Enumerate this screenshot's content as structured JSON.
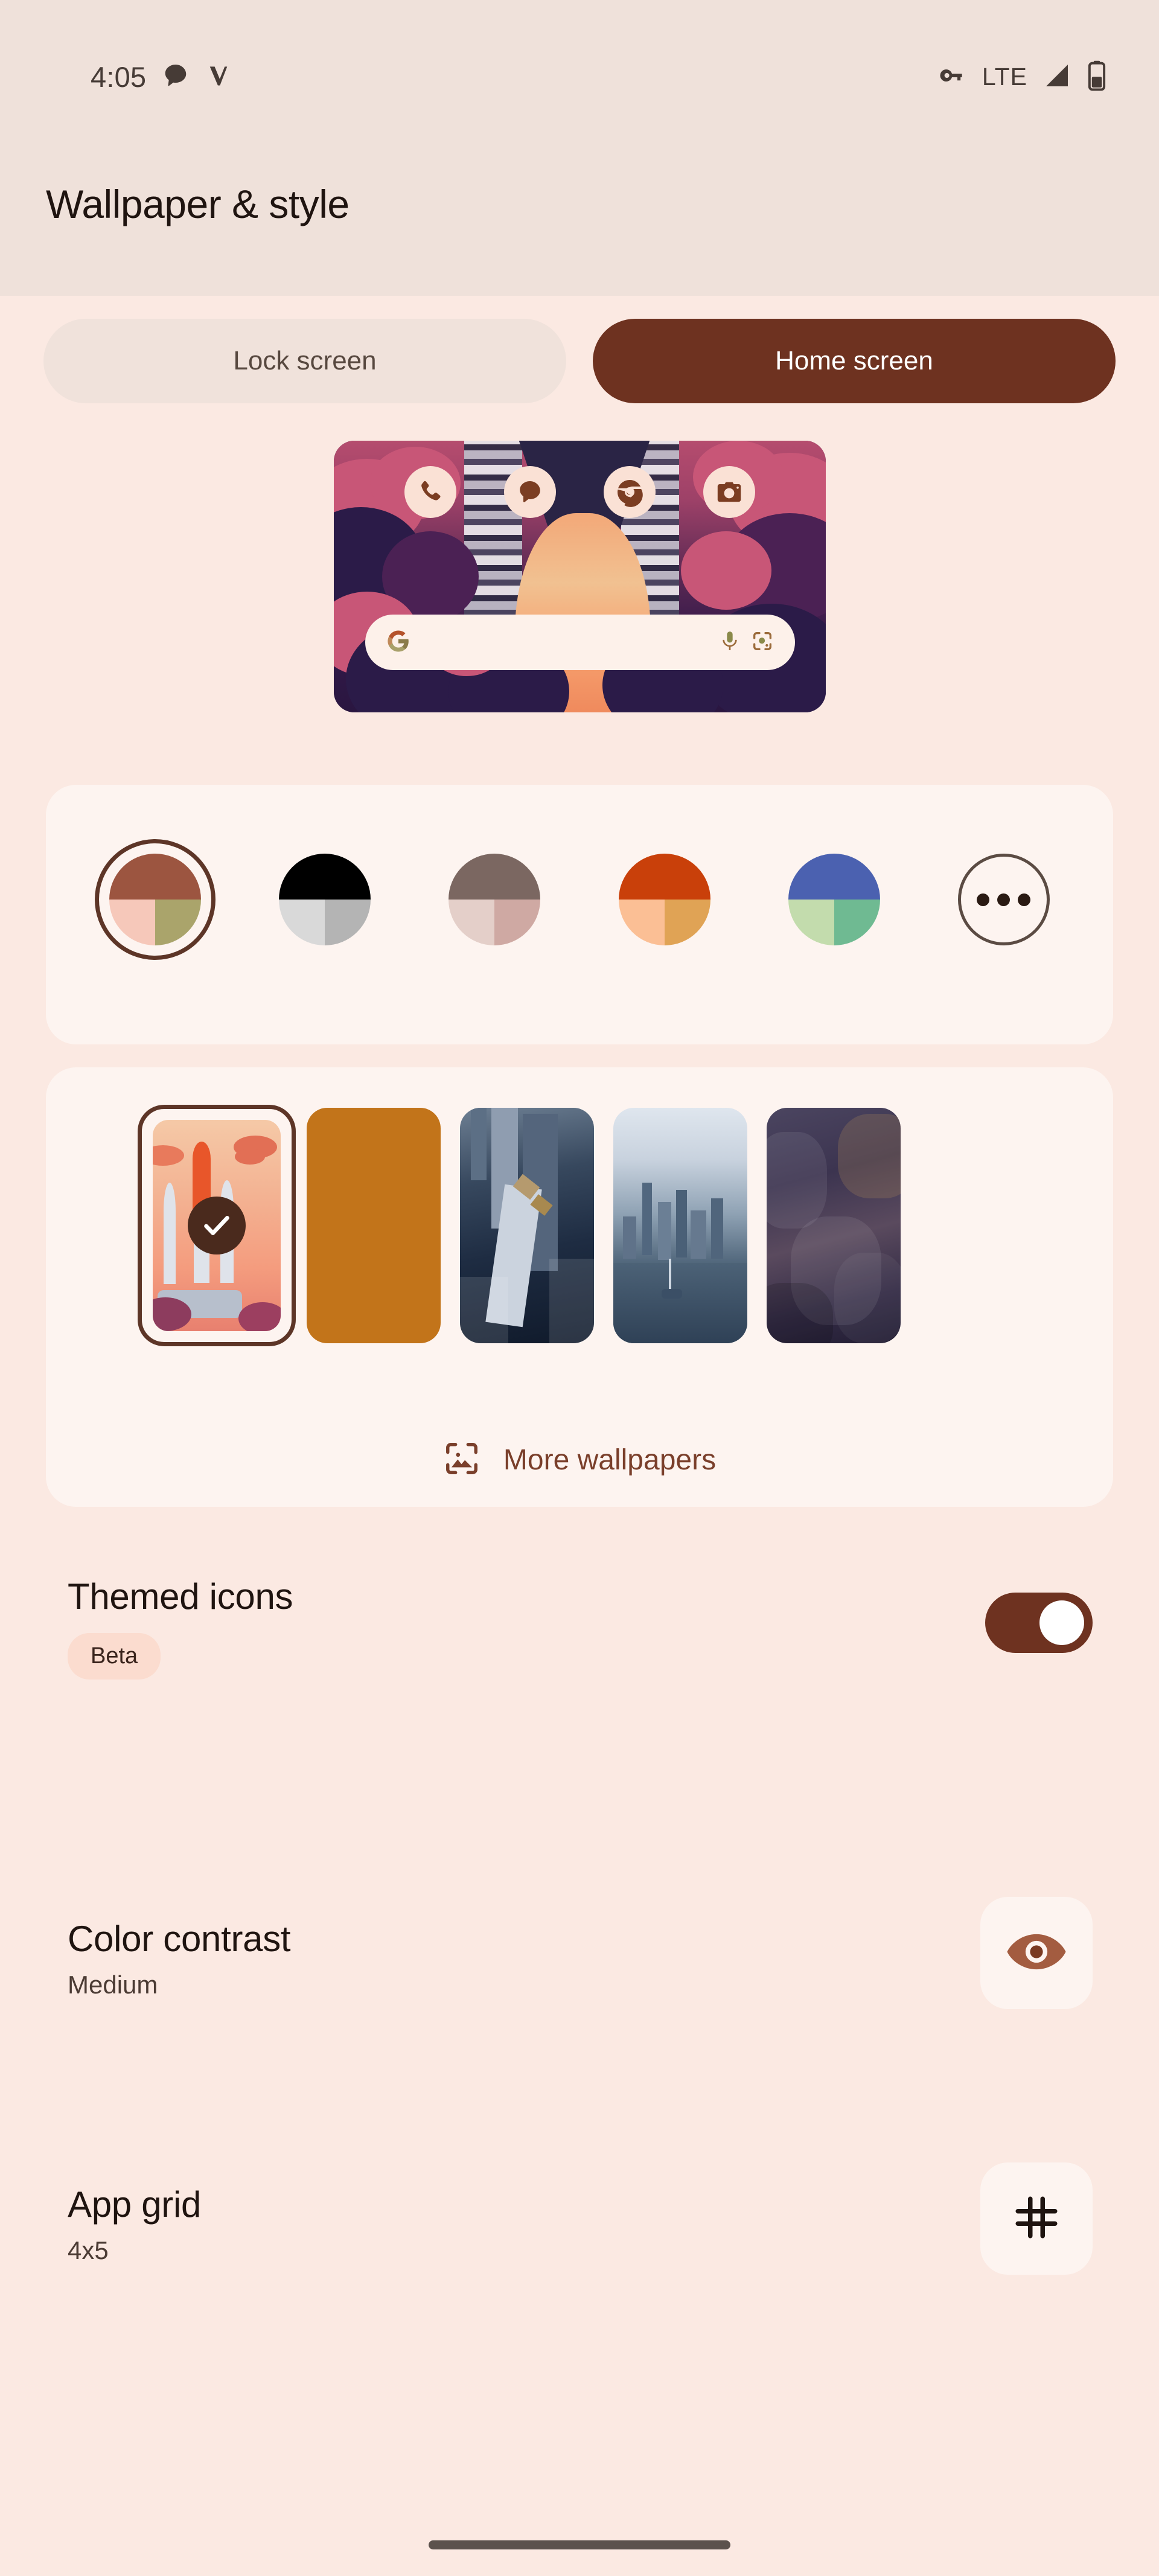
{
  "status_bar": {
    "time": "4:05",
    "network_label": "LTE",
    "left_icons": [
      "chat-bubble-icon",
      "vpn-check-icon"
    ],
    "right_icons": [
      "vpn-key-icon",
      "signal-icon",
      "battery-icon"
    ]
  },
  "header": {
    "title": "Wallpaper & style"
  },
  "tabs": [
    {
      "label": "Lock screen",
      "active": false
    },
    {
      "label": "Home screen",
      "active": true
    }
  ],
  "preview": {
    "name": "home-screen-preview",
    "dock_icons": [
      "phone-icon",
      "messages-icon",
      "chrome-icon",
      "camera-icon"
    ],
    "search_icons": [
      "google-g-icon",
      "microphone-icon",
      "lens-icon"
    ]
  },
  "color_swatches": [
    {
      "name": "wallpaper-color-1",
      "selected": true,
      "top": "#9c5540",
      "bottom_left": "#f6c8ba",
      "bottom_right": "#aaa46b"
    },
    {
      "name": "wallpaper-color-2",
      "selected": false,
      "top": "#000000",
      "bottom_left": "#d9d9d9",
      "bottom_right": "#b4b4b4"
    },
    {
      "name": "wallpaper-color-3",
      "selected": false,
      "top": "#7b6761",
      "bottom_left": "#e4cfc9",
      "bottom_right": "#cfa9a3"
    },
    {
      "name": "wallpaper-color-4",
      "selected": false,
      "top": "#c9400a",
      "bottom_left": "#fbbf95",
      "bottom_right": "#e0a355"
    },
    {
      "name": "wallpaper-color-5",
      "selected": false,
      "top": "#4b61b0",
      "bottom_left": "#c3dcad",
      "bottom_right": "#6fba92"
    },
    {
      "name": "more-colors",
      "selected": false,
      "is_more": true
    }
  ],
  "wallpapers": [
    {
      "name": "wallpaper-rocket-launch",
      "selected": true,
      "art": "rocket"
    },
    {
      "name": "wallpaper-solid-orange",
      "selected": false,
      "art": "orange"
    },
    {
      "name": "wallpaper-skyscraper",
      "selected": false,
      "art": "skyscraper"
    },
    {
      "name": "wallpaper-city-skyline",
      "selected": false,
      "art": "city"
    },
    {
      "name": "wallpaper-rocky-canyon",
      "selected": false,
      "art": "rock"
    }
  ],
  "more_wallpapers": {
    "label": "More wallpapers",
    "icon": "image-frame-icon"
  },
  "settings": [
    {
      "name": "themed-icons",
      "title": "Themed icons",
      "badge": "Beta",
      "control": "toggle",
      "toggle_on": true
    },
    {
      "name": "color-contrast",
      "title": "Color contrast",
      "subtitle": "Medium",
      "control": "icon-tile",
      "icon": "eye-icon"
    },
    {
      "name": "app-grid",
      "title": "App grid",
      "subtitle": "4x5",
      "control": "icon-tile",
      "icon": "grid-icon"
    }
  ],
  "colors": {
    "accent": "#6e3220",
    "background": "#fbe9e2",
    "status_bar_bg": "#efe1da",
    "card": "#fdf4f0",
    "on_surface": "#1f1410",
    "link": "#7a3f2b"
  },
  "nav_bar": {
    "name": "gesture-handle"
  }
}
